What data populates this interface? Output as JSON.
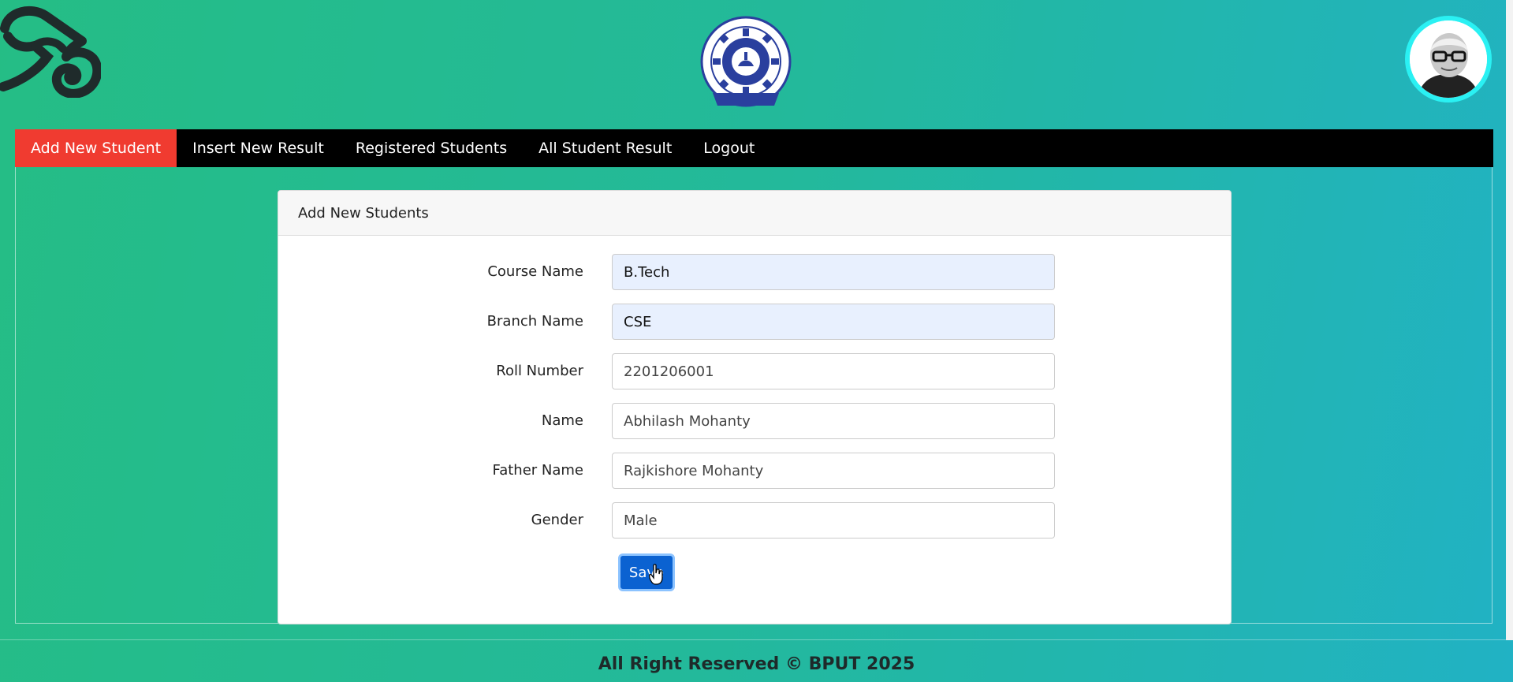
{
  "header": {
    "left_logo_icon": "odia-script-logo-icon",
    "center_logo_icon": "university-seal-icon",
    "avatar_icon": "user-avatar-portrait"
  },
  "nav": {
    "items": [
      {
        "label": "Add New Student",
        "active": true
      },
      {
        "label": "Insert New Result",
        "active": false
      },
      {
        "label": "Registered Students",
        "active": false
      },
      {
        "label": "All Student Result",
        "active": false
      },
      {
        "label": "Logout",
        "active": false
      }
    ]
  },
  "card": {
    "title": "Add New Students",
    "fields": [
      {
        "label": "Course Name",
        "value": "B.Tech"
      },
      {
        "label": "Branch Name",
        "value": "CSE"
      },
      {
        "label": "Roll Number",
        "value": "2201206001"
      },
      {
        "label": "Name",
        "value": "Abhilash Mohanty"
      },
      {
        "label": "Father Name",
        "value": "Rajkishore Mohanty"
      },
      {
        "label": "Gender",
        "value": "Male"
      }
    ],
    "save_label": "Save"
  },
  "footer": {
    "text": "All Right Reserved © BPUT 2025"
  },
  "colors": {
    "nav_active": "#f03b30",
    "save_button": "#0b62d1",
    "avatar_ring": "#2af1f3"
  }
}
